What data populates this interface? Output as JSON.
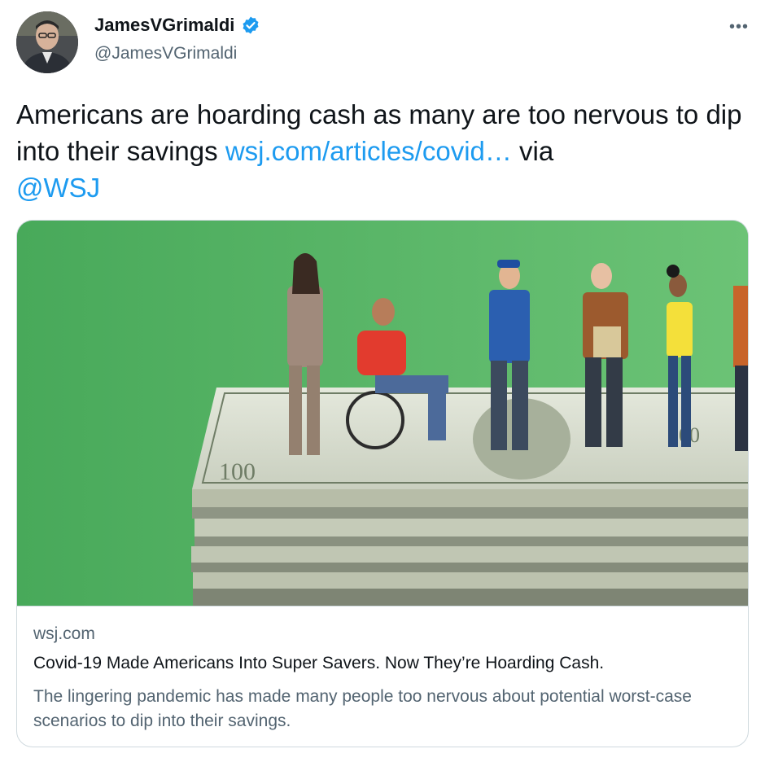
{
  "author": {
    "display_name": "JamesVGrimaldi",
    "handle": "@JamesVGrimaldi",
    "verified": true,
    "avatar_icon": "profile-photo"
  },
  "menu": {
    "more_icon": "•••"
  },
  "tweet": {
    "text_main": "Americans are hoarding cash as many are too nervous to dip into their savings ",
    "link_text": "wsj.com/articles/covid…",
    "text_via": " via ",
    "mention": "@WSJ"
  },
  "card": {
    "domain": "wsj.com",
    "title": "Covid-19 Made Americans Into Super Savers. Now They’re Hoarding Cash.",
    "description": "The lingering pandemic has made many people too nervous about potential worst-case scenarios to dip into their savings."
  },
  "colors": {
    "link": "#1d9bf0",
    "verified_badge": "#1d9bf0",
    "card_background": "#5ab86a",
    "secondary_text": "#536471"
  }
}
